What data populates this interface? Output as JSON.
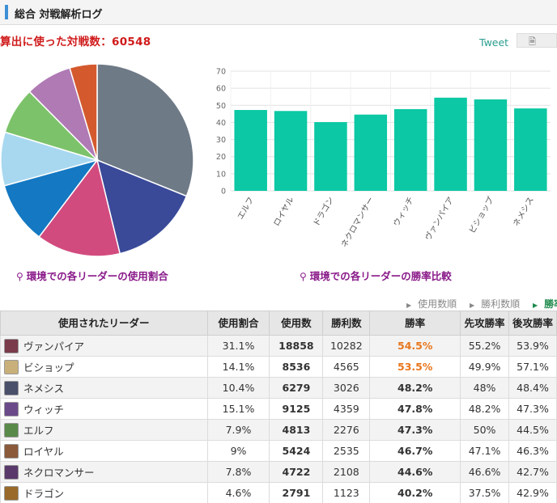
{
  "header": {
    "title": "総合 対戦解析ログ"
  },
  "total_label": "算出に使った対戦数：60548",
  "tweet_label": "Tweet",
  "save_icon": "document-icon",
  "captions": {
    "pie": "環境での各リーダーの使用割合",
    "bar": "環境での各リーダーの勝率比較"
  },
  "sort_links": [
    {
      "label": "使用数順",
      "active": false
    },
    {
      "label": "勝利数順",
      "active": false
    },
    {
      "label": "勝率順",
      "active": true
    }
  ],
  "table": {
    "columns": [
      "使用されたリーダー",
      "使用割合",
      "使用数",
      "勝利数",
      "勝率",
      "先攻勝率",
      "後攻勝率"
    ],
    "rows": [
      {
        "leader": "ヴァンパイア",
        "share": "31.1%",
        "uses": "18858",
        "wins": "10282",
        "winrate": "54.5%",
        "first": "55.2%",
        "second": "53.9%",
        "hot": true,
        "color": "#7a3b4b"
      },
      {
        "leader": "ビショップ",
        "share": "14.1%",
        "uses": "8536",
        "wins": "4565",
        "winrate": "53.5%",
        "first": "49.9%",
        "second": "57.1%",
        "hot": true,
        "color": "#c9b07a"
      },
      {
        "leader": "ネメシス",
        "share": "10.4%",
        "uses": "6279",
        "wins": "3026",
        "winrate": "48.2%",
        "first": "48%",
        "second": "48.4%",
        "hot": false,
        "color": "#4a4f6a"
      },
      {
        "leader": "ウィッチ",
        "share": "15.1%",
        "uses": "9125",
        "wins": "4359",
        "winrate": "47.8%",
        "first": "48.2%",
        "second": "47.3%",
        "hot": false,
        "color": "#6b4a8a"
      },
      {
        "leader": "エルフ",
        "share": "7.9%",
        "uses": "4813",
        "wins": "2276",
        "winrate": "47.3%",
        "first": "50%",
        "second": "44.5%",
        "hot": false,
        "color": "#5a8a4a"
      },
      {
        "leader": "ロイヤル",
        "share": "9%",
        "uses": "5424",
        "wins": "2535",
        "winrate": "46.7%",
        "first": "47.1%",
        "second": "46.3%",
        "hot": false,
        "color": "#8a5a3a"
      },
      {
        "leader": "ネクロマンサー",
        "share": "7.8%",
        "uses": "4722",
        "wins": "2108",
        "winrate": "44.6%",
        "first": "46.6%",
        "second": "42.7%",
        "hot": false,
        "color": "#5a3a6a"
      },
      {
        "leader": "ドラゴン",
        "share": "4.6%",
        "uses": "2791",
        "wins": "1123",
        "winrate": "40.2%",
        "first": "37.5%",
        "second": "42.9%",
        "hot": false,
        "color": "#9a6a2a"
      }
    ]
  },
  "chart_data": [
    {
      "type": "pie",
      "slices": [
        {
          "label": "ヴァンパイア",
          "value": 31.1,
          "color": "#6f7a87"
        },
        {
          "label": "ネメシス",
          "value": 15.1,
          "color": "#3a4a99"
        },
        {
          "label": "ビショップ",
          "value": 14.1,
          "color": "#d24b7e"
        },
        {
          "label": "ウィッチ",
          "value": 10.4,
          "color": "#1478c2"
        },
        {
          "label": "ロイヤル",
          "value": 9.0,
          "color": "#a8d8f0"
        },
        {
          "label": "エルフ",
          "value": 7.9,
          "color": "#7cc26a"
        },
        {
          "label": "ネクロマンサー",
          "value": 7.8,
          "color": "#b07ab5"
        },
        {
          "label": "ドラゴン",
          "value": 4.6,
          "color": "#d45a2e"
        }
      ]
    },
    {
      "type": "bar",
      "categories": [
        "エルフ",
        "ロイヤル",
        "ドラゴン",
        "ネクロマンサー",
        "ウィッチ",
        "ヴァンパイア",
        "ビショップ",
        "ネメシス"
      ],
      "values": [
        47.3,
        46.7,
        40.2,
        44.6,
        47.8,
        54.5,
        53.5,
        48.2
      ],
      "ylim": [
        0,
        70
      ],
      "yticks": [
        0,
        10,
        20,
        30,
        40,
        50,
        60,
        70
      ],
      "grid": true,
      "color": "#0cc8a4"
    }
  ]
}
